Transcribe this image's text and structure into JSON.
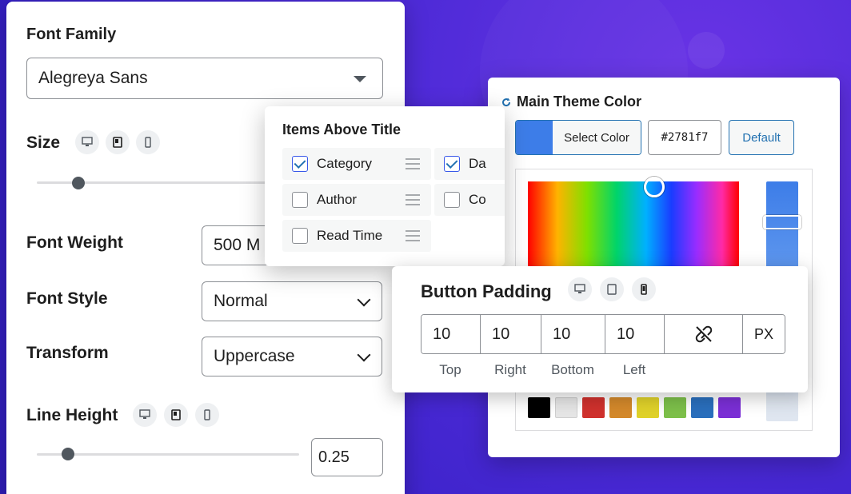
{
  "typography": {
    "font_family_label": "Font Family",
    "font_family_value": "Alegreya Sans",
    "size_label": "Size",
    "font_weight_label": "Font Weight",
    "font_weight_value": "500 M",
    "font_style_label": "Font Style",
    "font_style_value": "Normal",
    "transform_label": "Transform",
    "transform_value": "Uppercase",
    "line_height_label": "Line Height",
    "line_height_value": "0.25"
  },
  "items": {
    "title": "Items Above Title",
    "rows": [
      {
        "label": "Category",
        "checked": true
      },
      {
        "label": "Da",
        "checked": true
      },
      {
        "label": "Author",
        "checked": false
      },
      {
        "label": "Co",
        "checked": false
      },
      {
        "label": "Read Time",
        "checked": false
      }
    ]
  },
  "color": {
    "title": "Main Theme Color",
    "select_label": "Select Color",
    "hex_value": "#2781f7",
    "default_label": "Default",
    "accent": "#3d7de8",
    "palette": [
      "#000000",
      "#e6e6e6",
      "#d0312d",
      "#d4892b",
      "#e0d22a",
      "#7dc04a",
      "#2a6fbd",
      "#7b2fd6"
    ]
  },
  "padding": {
    "title": "Button Padding",
    "values": [
      "10",
      "10",
      "10",
      "10"
    ],
    "labels": [
      "Top",
      "Right",
      "Bottom",
      "Left"
    ],
    "unit": "PX"
  }
}
